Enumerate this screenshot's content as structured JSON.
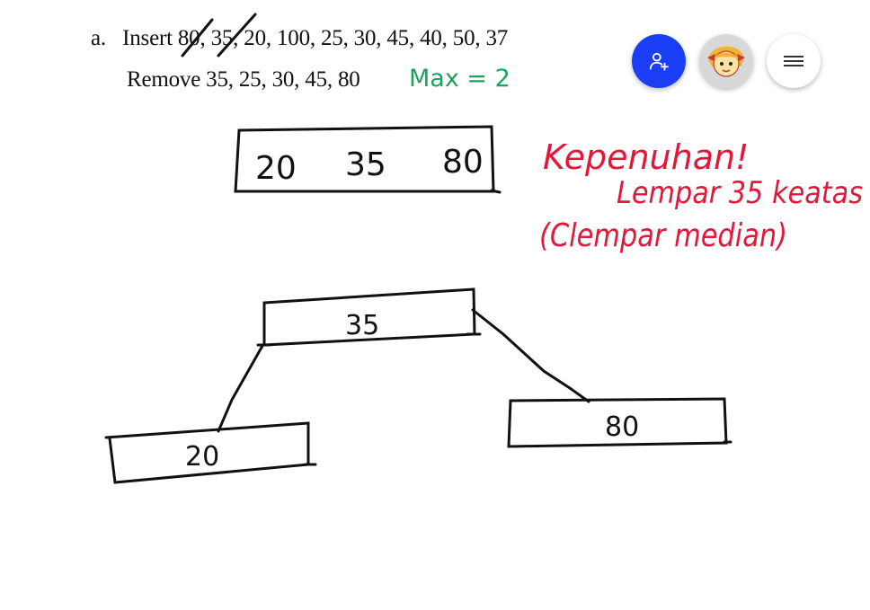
{
  "document": {
    "line1_label": "a.",
    "line1_text": "Insert 80, 35, 20, 100, 25, 30, 45, 40, 50, 37",
    "line2_text": "Remove 35, 25, 30, 45, 80"
  },
  "annotations": {
    "max_note": "Max = 2",
    "note_line1": "Kepenuhan!",
    "note_line2": "Lempar 35 keatas",
    "note_line3": "(Clempar median)"
  },
  "tree": {
    "full_node": [
      "20",
      "35",
      "80"
    ],
    "root": "35",
    "left_child": "20",
    "right_child": "80"
  },
  "toolbar": {
    "add_user_icon": "person-add-icon",
    "avatar_icon": "avatar",
    "menu_icon": "hamburger-menu-icon"
  },
  "colors": {
    "ink_black": "#111111",
    "ink_green": "#1aa35a",
    "ink_red": "#e2173a",
    "accent_blue": "#1a3ef5"
  }
}
